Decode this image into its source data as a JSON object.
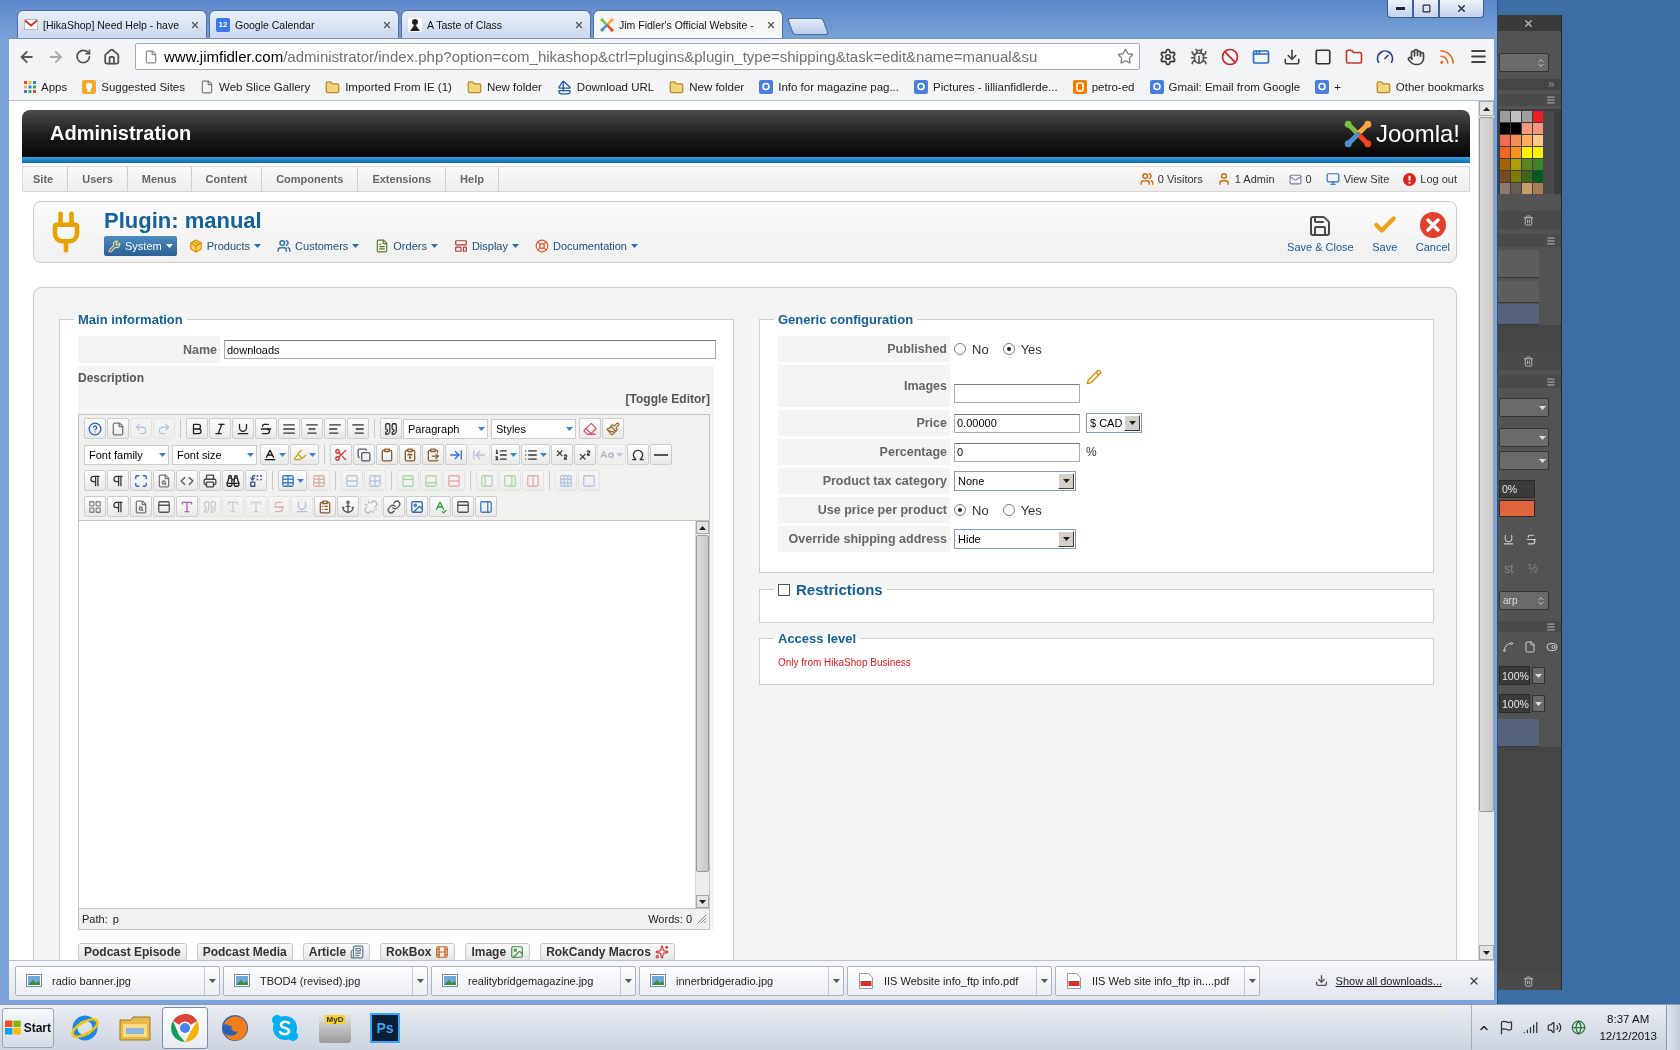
{
  "browser": {
    "tabs": [
      {
        "title": "[HikaShop] Need Help - have",
        "kind": "mail",
        "selected": false
      },
      {
        "title": "Google Calendar",
        "kind": "calendar",
        "icon_text": "12",
        "selected": false
      },
      {
        "title": "A Taste of Class",
        "kind": "site",
        "selected": false
      },
      {
        "title": "Jim Fidler's Official Website -",
        "kind": "joomla",
        "selected": true
      }
    ],
    "address": {
      "host": "www.jimfidler.com",
      "path": "/administrator/index.php?option=com_hikashop&ctrl=plugins&plugin_type=shipping&task=edit&name=manual&su"
    },
    "bookmarks": [
      {
        "label": "Apps",
        "kind": "apps"
      },
      {
        "label": "Suggested Sites",
        "kind": "bulb"
      },
      {
        "label": "Web Slice Gallery",
        "kind": "page"
      },
      {
        "label": "Imported From IE (1)",
        "kind": "folder"
      },
      {
        "label": "New folder",
        "kind": "folder"
      },
      {
        "label": "Download URL",
        "kind": "sail"
      },
      {
        "label": "New folder",
        "kind": "folder"
      },
      {
        "label": "Info for magazine pag...",
        "kind": "tile"
      },
      {
        "label": "Pictures - lillianfidlerde...",
        "kind": "tile"
      },
      {
        "label": "petro-ed",
        "kind": "orange_tile"
      },
      {
        "label": "Gmail: Email from Google",
        "kind": "tile"
      },
      {
        "label": "+",
        "kind": "tile"
      }
    ],
    "other_bookmarks": "Other bookmarks"
  },
  "admin": {
    "title": "Administration",
    "logo": "Joomla!",
    "menu": [
      "Site",
      "Users",
      "Menus",
      "Content",
      "Components",
      "Extensions",
      "Help"
    ],
    "status": [
      {
        "label": "0 Visitors",
        "kind": "users"
      },
      {
        "label": "1 Admin",
        "kind": "user"
      },
      {
        "label": "0",
        "kind": "mail"
      },
      {
        "label": "View Site",
        "kind": "monitor"
      },
      {
        "label": "Log out",
        "kind": "logout"
      }
    ]
  },
  "toolbar": {
    "title": "Plugin: manual",
    "submenu": [
      {
        "label": "System",
        "kind": "system",
        "selected": true
      },
      {
        "label": "Products",
        "kind": "products",
        "selected": false
      },
      {
        "label": "Customers",
        "kind": "customers",
        "selected": false
      },
      {
        "label": "Orders",
        "kind": "orders",
        "selected": false
      },
      {
        "label": "Display",
        "kind": "display",
        "selected": false
      },
      {
        "label": "Documentation",
        "kind": "documentation",
        "selected": false
      }
    ],
    "actions": [
      {
        "label": "Save & Close",
        "kind": "save"
      },
      {
        "label": "Save",
        "kind": "apply"
      },
      {
        "label": "Cancel",
        "kind": "cancel"
      }
    ]
  },
  "main_information": {
    "legend": "Main information",
    "name_label": "Name",
    "name_value": "downloads",
    "description_label": "Description",
    "toggle_editor": "[Toggle Editor]",
    "editor": {
      "rows": [
        [
          [
            {
              "kind": "help",
              "disabled": false
            },
            {
              "kind": "newdocument",
              "disabled": false
            },
            {
              "kind": "undo",
              "disabled": true
            },
            {
              "kind": "redo",
              "disabled": true
            }
          ],
          [
            {
              "kind": "bold",
              "disabled": false
            },
            {
              "kind": "italic",
              "disabled": false
            },
            {
              "kind": "underline",
              "disabled": false
            },
            {
              "kind": "strikethrough",
              "disabled": false
            },
            {
              "kind": "justifyfull",
              "disabled": false
            },
            {
              "kind": "justifycenter",
              "disabled": false
            },
            {
              "kind": "justifyleft",
              "disabled": false
            },
            {
              "kind": "justifyright",
              "disabled": false
            }
          ],
          [
            {
              "kind": "blockquote",
              "disabled": false
            },
            {
              "kind": "select",
              "value": "Paragraph",
              "disabled": false
            },
            {
              "kind": "select",
              "value": "Styles",
              "disabled": false
            },
            {
              "kind": "cleanup",
              "disabled": false
            },
            {
              "kind": "removeformat",
              "disabled": false
            }
          ]
        ],
        [
          [
            {
              "kind": "select",
              "value": "Font family",
              "disabled": false
            },
            {
              "kind": "select",
              "value": "Font size",
              "disabled": false
            },
            {
              "kind": "forecolor",
              "disabled": false
            },
            {
              "kind": "hilitecolor",
              "disabled": false
            }
          ],
          [
            {
              "kind": "cut",
              "disabled": false
            },
            {
              "kind": "copy",
              "disabled": false
            },
            {
              "kind": "paste",
              "disabled": false
            },
            {
              "kind": "pastetext",
              "disabled": false
            },
            {
              "kind": "pasteword",
              "disabled": false
            },
            {
              "kind": "indent",
              "disabled": false
            },
            {
              "kind": "outdent",
              "disabled": true
            },
            {
              "kind": "numlist",
              "disabled": false
            },
            {
              "kind": "bullist",
              "disabled": false
            },
            {
              "kind": "sub",
              "disabled": false
            },
            {
              "kind": "sup",
              "disabled": false
            },
            {
              "kind": "textstyle",
              "disabled": true
            },
            {
              "kind": "charmap",
              "disabled": false
            },
            {
              "kind": "hr",
              "disabled": false
            }
          ]
        ],
        [
          [
            {
              "kind": "ltr",
              "disabled": false
            },
            {
              "kind": "rtl",
              "disabled": false
            },
            {
              "kind": "fullscreen",
              "disabled": false
            },
            {
              "kind": "preview",
              "disabled": false
            },
            {
              "kind": "code",
              "disabled": false
            },
            {
              "kind": "print",
              "disabled": false
            },
            {
              "kind": "search",
              "disabled": false
            },
            {
              "kind": "replace",
              "disabled": false
            }
          ],
          [
            {
              "kind": "table",
              "disabled": false
            },
            {
              "kind": "deletetable",
              "disabled": true
            }
          ],
          [
            {
              "kind": "rowprops",
              "disabled": true
            },
            {
              "kind": "cellprops",
              "disabled": true
            }
          ],
          [
            {
              "kind": "rowbefore",
              "disabled": true
            },
            {
              "kind": "rowafter",
              "disabled": true
            },
            {
              "kind": "deleterow",
              "disabled": true
            }
          ],
          [
            {
              "kind": "colbefore",
              "disabled": true
            },
            {
              "kind": "colafter",
              "disabled": true
            },
            {
              "kind": "deletecol",
              "disabled": true
            }
          ],
          [
            {
              "kind": "splitcells",
              "disabled": true
            },
            {
              "kind": "mergecells",
              "disabled": true
            }
          ]
        ],
        [
          [
            {
              "kind": "visualaid",
              "disabled": false
            },
            {
              "kind": "visualchars",
              "disabled": false
            },
            {
              "kind": "nonbreaking",
              "disabled": false
            },
            {
              "kind": "template",
              "disabled": false
            },
            {
              "kind": "styleprops",
              "disabled": false
            },
            {
              "kind": "cite",
              "disabled": true
            },
            {
              "kind": "abbr",
              "disabled": true
            },
            {
              "kind": "acronym",
              "disabled": true
            },
            {
              "kind": "del",
              "disabled": true
            },
            {
              "kind": "ins",
              "disabled": true
            },
            {
              "kind": "attribs",
              "disabled": false
            },
            {
              "kind": "anchor",
              "disabled": false
            },
            {
              "kind": "unlink",
              "disabled": true
            },
            {
              "kind": "link",
              "disabled": false
            },
            {
              "kind": "image",
              "disabled": false
            },
            {
              "kind": "spellchecker",
              "disabled": false
            },
            {
              "kind": "advhr",
              "disabled": false
            },
            {
              "kind": "insertlayer",
              "disabled": false
            }
          ]
        ]
      ],
      "path_label": "Path:",
      "path_value": "p",
      "words": "Words: 0"
    },
    "plugin_buttons": [
      {
        "label": "Podcast Episode",
        "kind": "text"
      },
      {
        "label": "Podcast Media",
        "kind": "text"
      },
      {
        "label": "Article",
        "kind": "article"
      },
      {
        "label": "RokBox",
        "kind": "rokbox"
      },
      {
        "label": "Image",
        "kind": "image"
      },
      {
        "label": "RokCandy Macros",
        "kind": "macros"
      }
    ]
  },
  "generic_configuration": {
    "legend": "Generic configuration",
    "rows": [
      {
        "label": "Published",
        "kind": "radio",
        "options": [
          {
            "label": "No",
            "selected": false
          },
          {
            "label": "Yes",
            "selected": true
          }
        ]
      },
      {
        "label": "Images",
        "kind": "image"
      },
      {
        "label": "Price",
        "kind": "price",
        "value": "0.00000",
        "currency": "$ CAD"
      },
      {
        "label": "Percentage",
        "kind": "percent",
        "value": "0",
        "unit": "%"
      },
      {
        "label": "Product tax category",
        "kind": "select",
        "value": "None"
      },
      {
        "label": "Use price per product",
        "kind": "radio",
        "options": [
          {
            "label": "No",
            "selected": true
          },
          {
            "label": "Yes",
            "selected": false
          }
        ]
      },
      {
        "label": "Override shipping address",
        "kind": "select",
        "value": "Hide"
      }
    ]
  },
  "restrictions": {
    "legend": "Restrictions",
    "checked": false
  },
  "access_level": {
    "legend": "Access level",
    "note": "Only from HikaShop Business"
  },
  "downloads": {
    "items": [
      {
        "name": "radio banner.jpg",
        "kind": "image"
      },
      {
        "name": "TBOD4 (revised).jpg",
        "kind": "image"
      },
      {
        "name": "realitybridgemagazine.jpg",
        "kind": "image"
      },
      {
        "name": "innerbridgeradio.jpg",
        "kind": "image"
      },
      {
        "name": "IIS Website info_ftp info.pdf",
        "kind": "pdf"
      },
      {
        "name": "IIS Web site info_ftp in....pdf",
        "kind": "pdf"
      }
    ],
    "show_all": "Show all downloads..."
  },
  "taskbar": {
    "start": "Start",
    "apps": [
      {
        "kind": "ie",
        "selected": false
      },
      {
        "kind": "explorer",
        "selected": false
      },
      {
        "kind": "chrome",
        "selected": true
      },
      {
        "kind": "firefox",
        "selected": false
      },
      {
        "kind": "skype",
        "selected": false
      },
      {
        "kind": "dvd",
        "label": "MyD",
        "selected": false
      },
      {
        "kind": "photoshop",
        "label": "Ps",
        "selected": false
      }
    ],
    "time": "8:37 AM",
    "date": "12/12/2013"
  },
  "side_panel": {
    "swatches": [
      {
        "color": "#9c9c9c"
      },
      {
        "color": "#c1c1c1"
      },
      {
        "color": "#9e9e9e"
      },
      {
        "color": "#ed1c24"
      },
      {
        "color": "#000000"
      },
      {
        "color": "#000000"
      },
      {
        "color": "#f5987f"
      },
      {
        "color": "#f7977a"
      },
      {
        "color": "#f26c4f"
      },
      {
        "color": "#f68e55"
      },
      {
        "color": "#fbaf5c"
      },
      {
        "color": "#fdc68a"
      },
      {
        "color": "#f26522"
      },
      {
        "color": "#f7941d"
      },
      {
        "color": "#fff200"
      },
      {
        "color": "#fff200"
      },
      {
        "color": "#a36209"
      },
      {
        "color": "#aba000"
      },
      {
        "color": "#598527"
      },
      {
        "color": "#3b8526"
      },
      {
        "color": "#754c24"
      },
      {
        "color": "#7d7d00"
      },
      {
        "color": "#406618"
      },
      {
        "color": "#005e20"
      },
      {
        "color": "#8a7a72"
      },
      {
        "color": "#6b5a50"
      },
      {
        "color": "#c69c6d"
      },
      {
        "color": "#a67c52"
      }
    ],
    "tracking": "0%",
    "glyph_buttons": [
      "st",
      "½"
    ],
    "antialias": "arp",
    "zoom_fields": [
      "100%",
      "100%"
    ]
  }
}
